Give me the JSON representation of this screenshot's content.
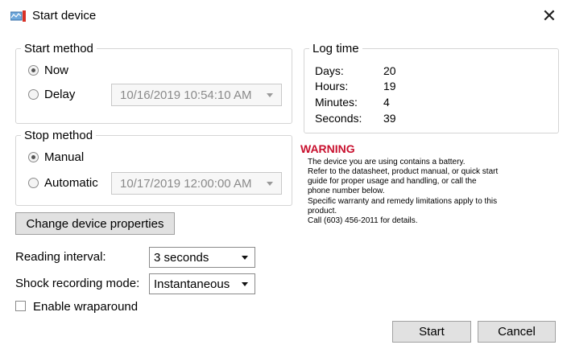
{
  "window": {
    "title": "Start device",
    "close_symbol": "✕"
  },
  "start_method": {
    "legend": "Start method",
    "now_label": "Now",
    "delay_label": "Delay",
    "delay_value": "10/16/2019 10:54:10 AM",
    "selected": "Now"
  },
  "stop_method": {
    "legend": "Stop method",
    "manual_label": "Manual",
    "automatic_label": "Automatic",
    "automatic_value": "10/17/2019 12:00:00 AM",
    "selected": "Manual"
  },
  "log_time": {
    "legend": "Log time",
    "rows": [
      {
        "label": "Days:",
        "value": "20"
      },
      {
        "label": "Hours:",
        "value": "19"
      },
      {
        "label": "Minutes:",
        "value": "4"
      },
      {
        "label": "Seconds:",
        "value": "39"
      }
    ]
  },
  "warning": {
    "title": "WARNING",
    "lines": [
      "The device you are using contains a battery.",
      "Refer to the datasheet, product manual, or quick start",
      "guide for proper usage and handling, or call the",
      "phone number below.",
      "Specific warranty and remedy limitations apply to this",
      "product.",
      "Call (603) 456-2011 for details."
    ],
    "color": "#c8102e"
  },
  "buttons": {
    "change_props": "Change device properties",
    "start": "Start",
    "cancel": "Cancel"
  },
  "settings": {
    "reading_interval_label": "Reading interval:",
    "reading_interval_value": "3 seconds",
    "shock_mode_label": "Shock recording mode:",
    "shock_mode_value": "Instantaneous",
    "wraparound_label": "Enable wraparound",
    "wraparound_checked": false
  }
}
